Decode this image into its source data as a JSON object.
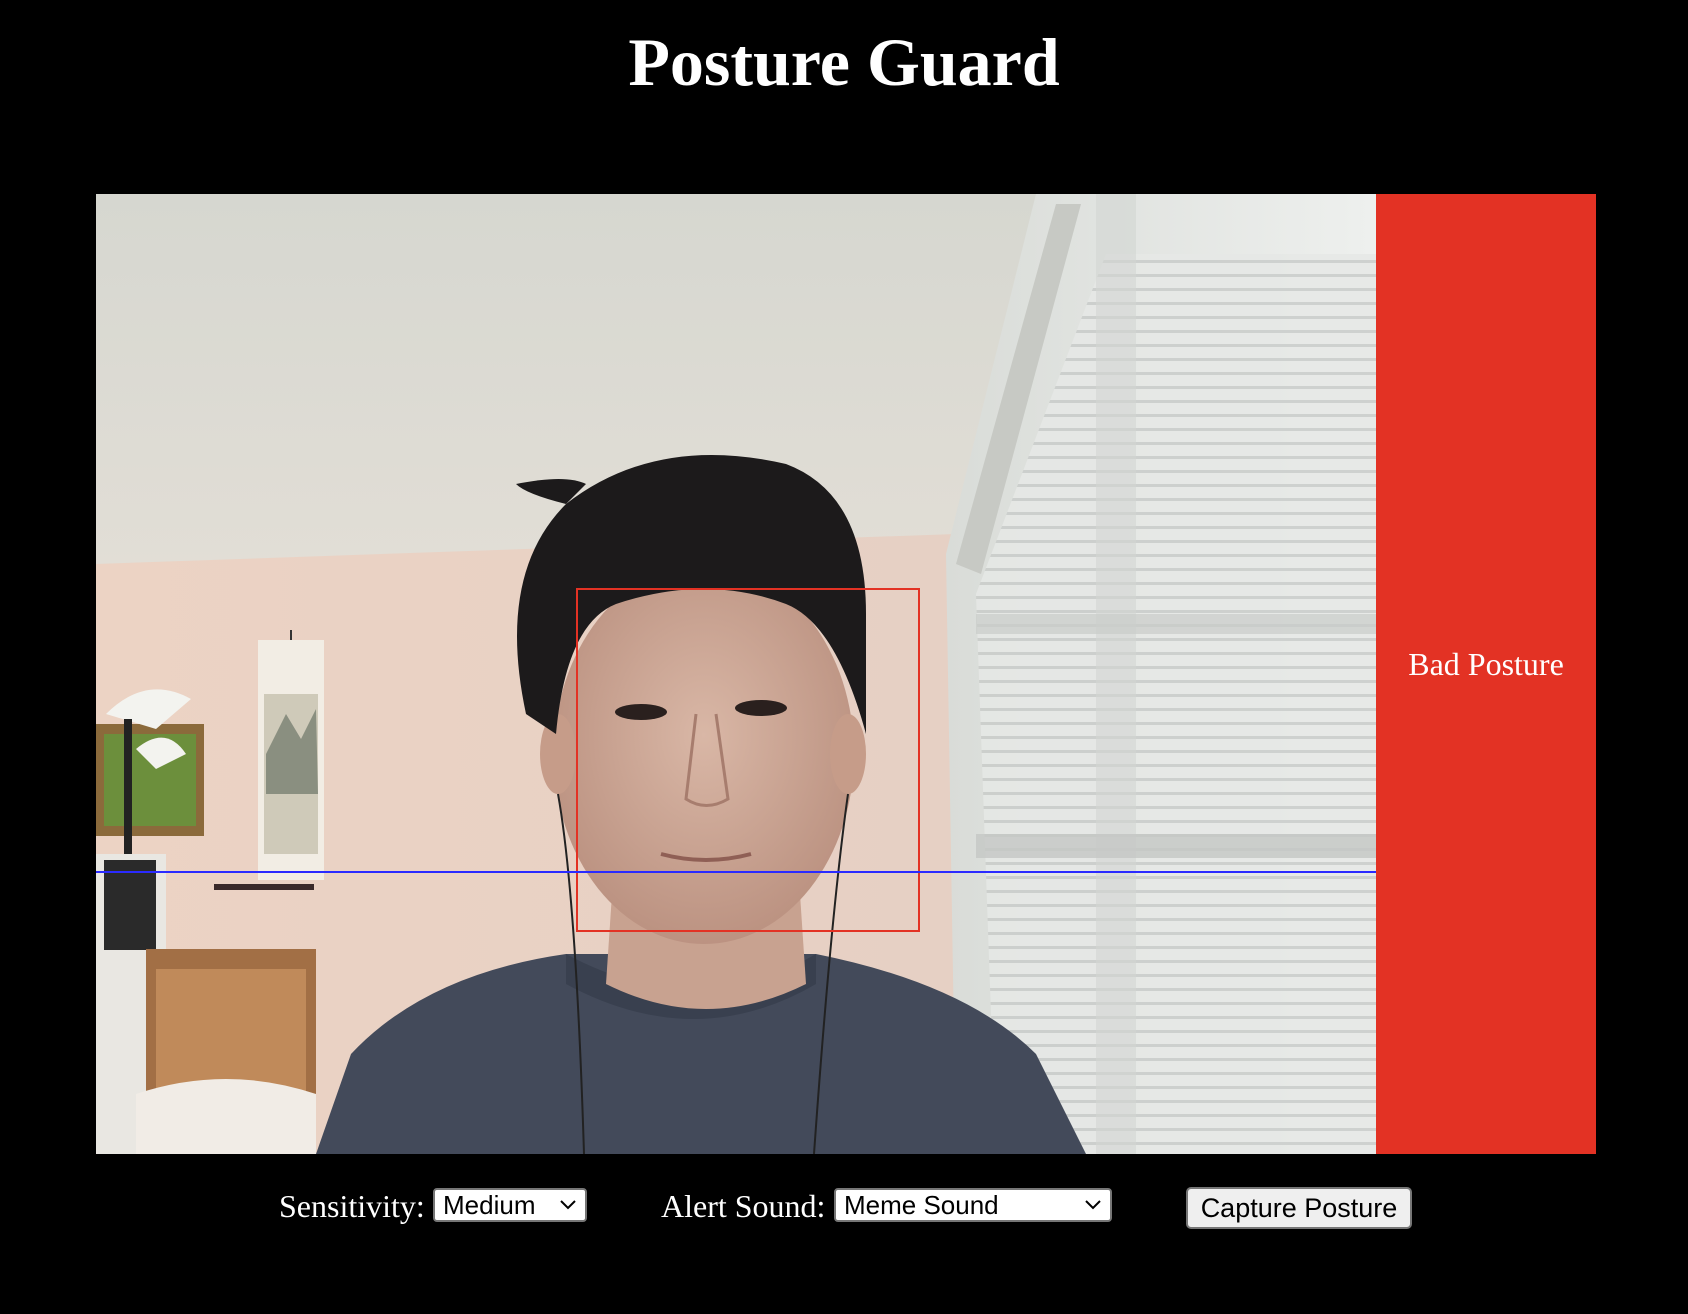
{
  "app": {
    "title": "Posture Guard"
  },
  "status": {
    "label": "Bad Posture",
    "color": "#e33224"
  },
  "controls": {
    "sensitivity_label": "Sensitivity:",
    "sensitivity_value": "Medium",
    "alert_sound_label": "Alert Sound:",
    "alert_sound_value": "Meme Sound",
    "capture_label": "Capture Posture"
  },
  "overlay": {
    "face_box_color": "#e33224",
    "baseline_color": "#2a2aff"
  }
}
